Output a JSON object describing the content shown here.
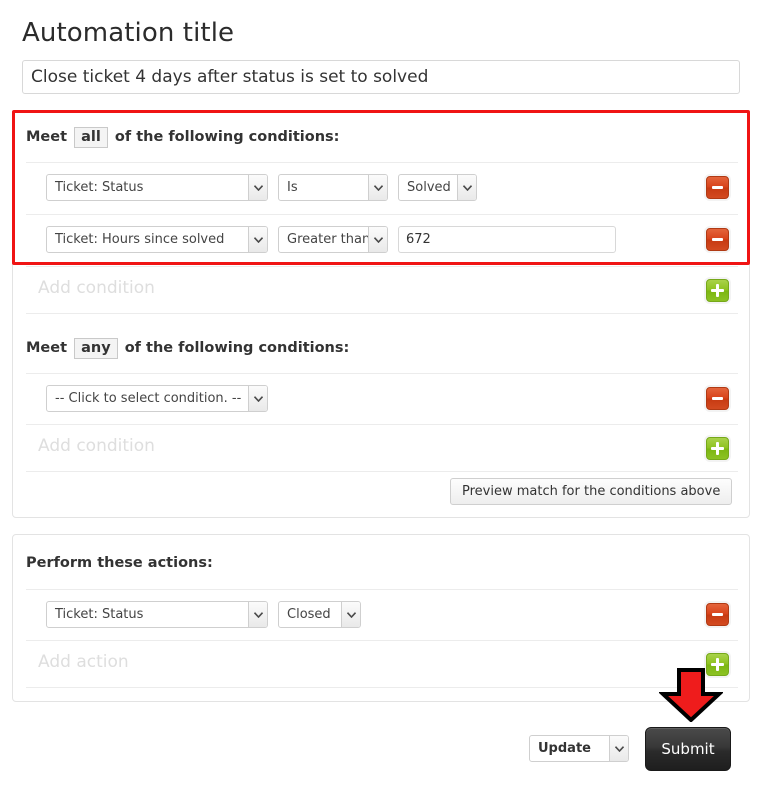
{
  "page": {
    "title": "Automation title"
  },
  "title_field": {
    "value": "Close ticket 4 days after status is set to solved",
    "placeholder": "Automation title"
  },
  "colors": {
    "highlight_red": "#f01414",
    "arrow_red": "#ef1c1c",
    "remove_button": "#d8421a",
    "add_button": "#8dc21f",
    "submit_button": "#2b2b2b"
  },
  "conditions_all": {
    "meet_prefix": "Meet",
    "operator": "all",
    "meet_suffix": "of the following conditions:",
    "rows": [
      {
        "field": "Ticket: Status",
        "operator": "Is",
        "value_kind": "select",
        "value": "Solved",
        "remove_label": "remove-condition"
      },
      {
        "field": "Ticket: Hours since solved",
        "operator": "Greater than",
        "value_kind": "text",
        "value": "672",
        "remove_label": "remove-condition"
      }
    ],
    "add_label": "Add condition"
  },
  "conditions_any": {
    "meet_prefix": "Meet",
    "operator": "any",
    "meet_suffix": "of the following conditions:",
    "rows": [
      {
        "field": "-- Click to select condition. --",
        "remove_label": "remove-condition"
      }
    ],
    "add_label": "Add condition"
  },
  "preview": {
    "label": "Preview match for the conditions above"
  },
  "actions": {
    "heading": "Perform these actions:",
    "rows": [
      {
        "field": "Ticket: Status",
        "value": "Closed",
        "remove_label": "remove-action"
      }
    ],
    "add_label": "Add action"
  },
  "footer": {
    "mode_select": "Update",
    "submit_label": "Submit"
  },
  "icons": {
    "chevron_down": "chevron-down-icon",
    "minus": "minus-icon",
    "plus": "plus-icon",
    "arrow_down": "red-down-arrow-annotation"
  }
}
